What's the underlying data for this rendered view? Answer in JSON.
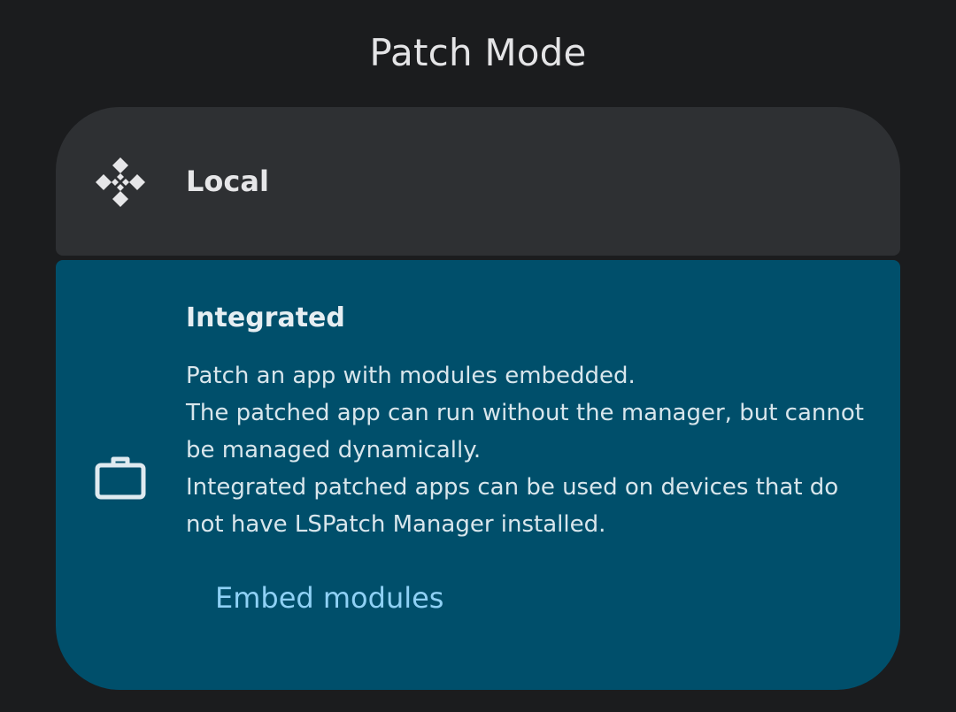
{
  "dialog": {
    "title": "Patch Mode"
  },
  "options": {
    "local": {
      "label": "Local",
      "icon": "local-diamond-icon"
    },
    "integrated": {
      "label": "Integrated",
      "icon": "briefcase-icon",
      "description_lines": [
        "Patch an app with modules embedded.",
        "The patched app can run without the manager, but cannot",
        "be managed dynamically.",
        "Integrated patched apps can be used on devices that do",
        "not have LSPatch Manager installed."
      ],
      "embed_button_label": "Embed modules",
      "selected": true
    }
  },
  "colors": {
    "background": "#1b1c1e",
    "local_card": "#2e3033",
    "integrated_card": "#004f6b",
    "accent_link": "#8fd1f5"
  }
}
